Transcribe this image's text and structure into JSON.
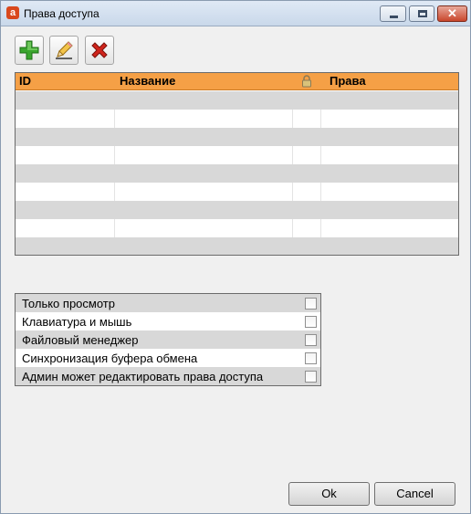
{
  "window": {
    "title": "Права доступа",
    "app_icon": "a"
  },
  "toolbar": {
    "add_icon": "plus-icon",
    "edit_icon": "pencil-icon",
    "delete_icon": "delete-x-icon"
  },
  "table": {
    "columns": [
      "ID",
      "Название",
      "lock-icon",
      "Права"
    ],
    "row_count": 9,
    "rows": []
  },
  "permissions": [
    {
      "label": "Только просмотр",
      "checked": false
    },
    {
      "label": "Клавиатура и мышь",
      "checked": false
    },
    {
      "label": "Файловый менеджер",
      "checked": false
    },
    {
      "label": "Синхронизация буфера обмена",
      "checked": false
    },
    {
      "label": "Админ может редактировать права доступа",
      "checked": false
    }
  ],
  "buttons": {
    "ok": "Ok",
    "cancel": "Cancel"
  },
  "colors": {
    "header_orange": "#f5a046",
    "row_gray": "#d8d8d8",
    "delete_red": "#d0241c",
    "add_green": "#3aa52e"
  }
}
